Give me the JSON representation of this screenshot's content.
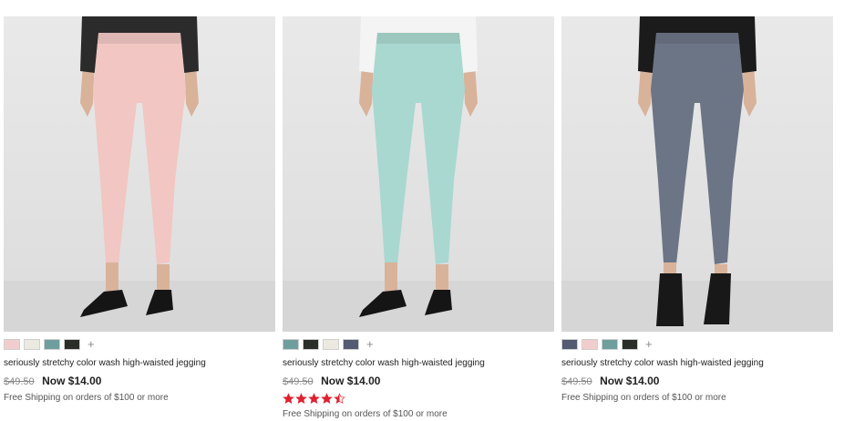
{
  "products": [
    {
      "title": "seriously stretchy color wash high-waisted jegging",
      "was_price": "$49.50",
      "now_price": "Now $14.00",
      "shipping": "Free Shipping on orders of $100 or more",
      "more_colors": "+",
      "pant_color": "#f1c6c3",
      "top_color": "#2b2b2b",
      "shoe_color": "#151515",
      "swatches": [
        "#f2cdcd",
        "#ece9e1",
        "#6f9e9f",
        "#2a2e29"
      ]
    },
    {
      "title": "seriously stretchy color wash high-waisted jegging",
      "was_price": "$49.50",
      "now_price": "Now $14.00",
      "shipping": "Free Shipping on orders of $100 or more",
      "more_colors": "+",
      "rating": 4.5,
      "rating_max": 5,
      "pant_color": "#a9d8d0",
      "top_color": "#f4f4f4",
      "shoe_color": "#151515",
      "swatches": [
        "#6f9e9f",
        "#2a2e29",
        "#ece9e1",
        "#535a72"
      ]
    },
    {
      "title": "seriously stretchy color wash high-waisted jegging",
      "was_price": "$49.50",
      "now_price": "Now $14.00",
      "shipping": "Free Shipping on orders of $100 or more",
      "more_colors": "+",
      "pant_color": "#6c7585",
      "top_color": "#1b1b1b",
      "shoe_color": "#181818",
      "swatches": [
        "#535a72",
        "#f2cdcd",
        "#6f9e9f",
        "#2a2e29"
      ]
    }
  ],
  "colors": {
    "star": "#e0212f",
    "strike": "#888888"
  }
}
